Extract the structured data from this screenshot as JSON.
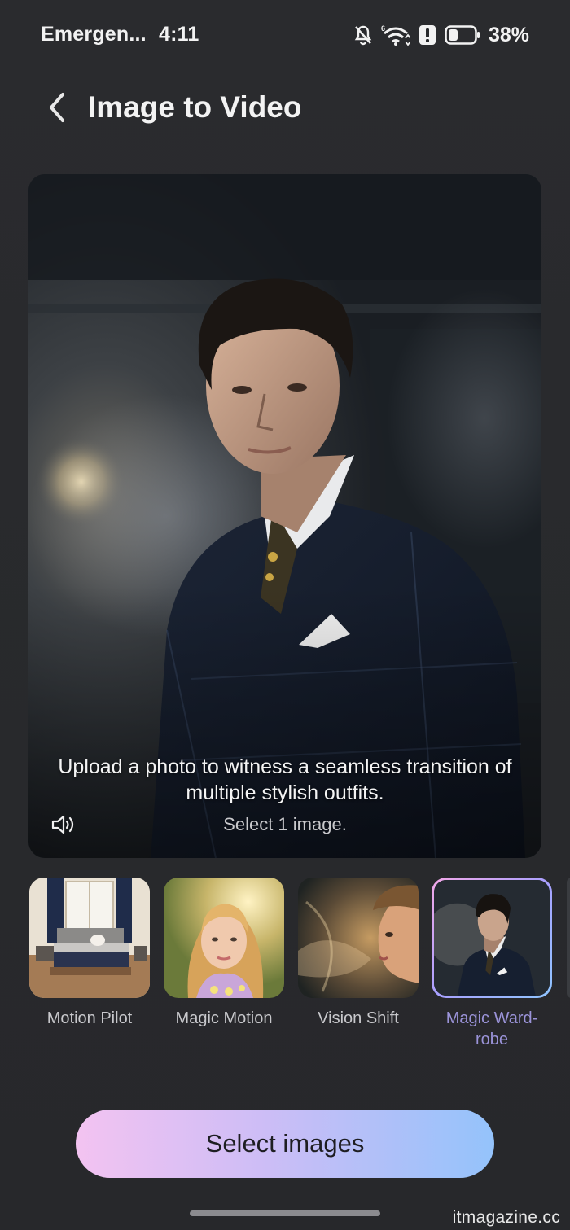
{
  "status_bar": {
    "carrier": "Emergen...",
    "time": "4:11",
    "battery_percent": "38%",
    "battery_level": 0.38,
    "icons": [
      "bell-muted-icon",
      "wifi-icon",
      "alert-icon",
      "battery-icon"
    ]
  },
  "header": {
    "title": "Image to Video",
    "back_icon": "chevron-left-icon"
  },
  "preview": {
    "caption": "Upload a photo to witness a seamless transition of multiple stylish outfits.",
    "hint": "Select 1 image.",
    "sound_icon": "speaker-icon"
  },
  "effects": [
    {
      "label": "Motion Pilot",
      "selected": false
    },
    {
      "label": "Magic Motion",
      "selected": false
    },
    {
      "label": "Vision Shift",
      "selected": false
    },
    {
      "label": "Magic Ward-robe",
      "selected": true
    }
  ],
  "cta": {
    "label": "Select images"
  },
  "watermark": "itmagazine.cc",
  "colors": {
    "background": "#28292c",
    "accent_selected": "#9b93d9",
    "cta_gradient": [
      "#f3c3f1",
      "#cdbdf6",
      "#94c3fb"
    ]
  }
}
